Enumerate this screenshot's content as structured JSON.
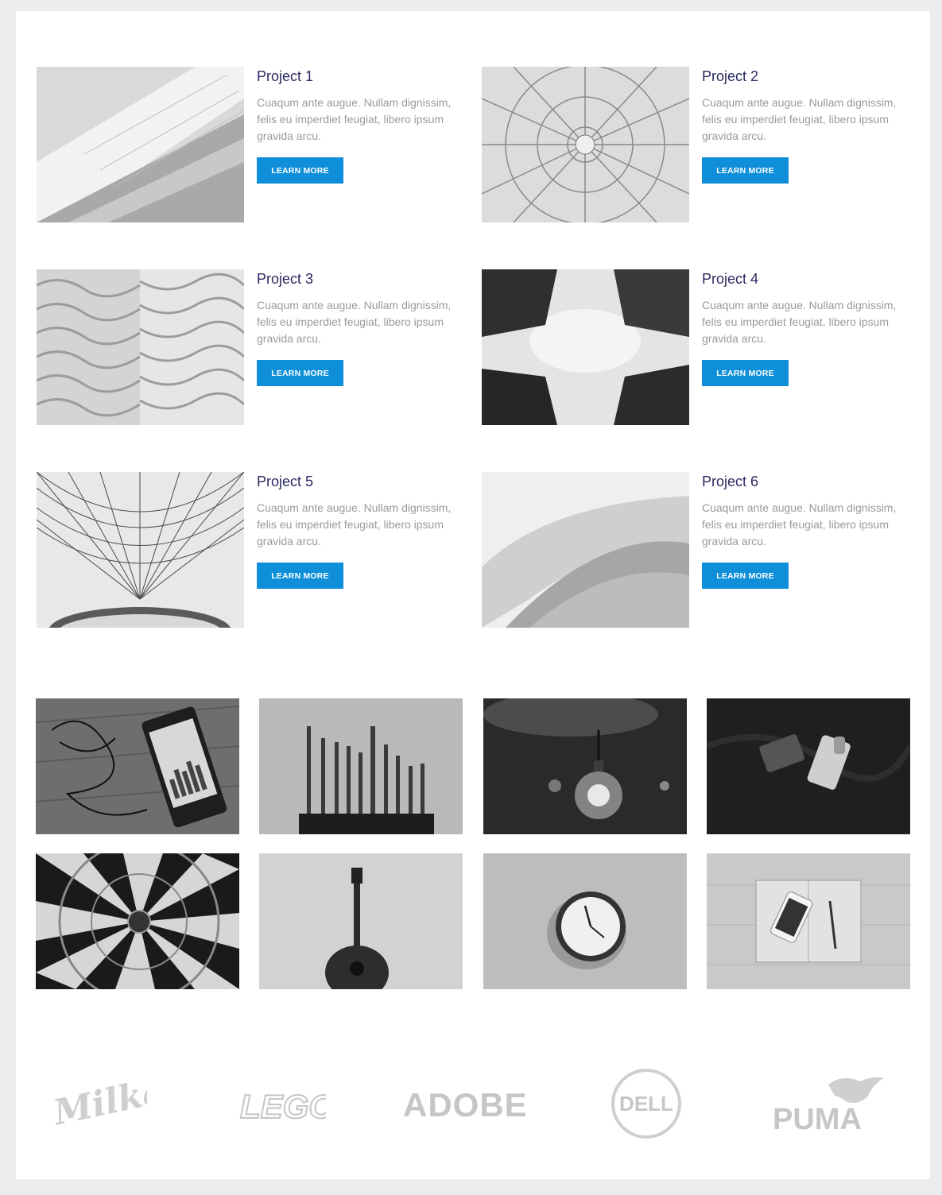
{
  "projects": [
    {
      "title": "Project 1",
      "description": "Cuaqum ante augue. Nullam dignissim, felis eu imperdiet feugiat, libero ipsum gravida arcu.",
      "button": "LEARN MORE"
    },
    {
      "title": "Project 2",
      "description": "Cuaqum ante augue. Nullam dignissim, felis eu imperdiet feugiat, libero ipsum gravida arcu.",
      "button": "LEARN MORE"
    },
    {
      "title": "Project 3",
      "description": "Cuaqum ante augue. Nullam dignissim, felis eu imperdiet feugiat, libero ipsum gravida arcu.",
      "button": "LEARN MORE"
    },
    {
      "title": "Project 4",
      "description": "Cuaqum ante augue. Nullam dignissim, felis eu imperdiet feugiat, libero ipsum gravida arcu.",
      "button": "LEARN MORE"
    },
    {
      "title": "Project 5",
      "description": "Cuaqum ante augue. Nullam dignissim, felis eu imperdiet feugiat, libero ipsum gravida arcu.",
      "button": "LEARN MORE"
    },
    {
      "title": "Project 6",
      "description": "Cuaqum ante augue. Nullam dignissim, felis eu imperdiet feugiat, libero ipsum gravida arcu.",
      "button": "LEARN MORE"
    }
  ],
  "gallery": [
    "phone-headphones",
    "drill-bits",
    "light-bulb",
    "phones-keys",
    "dartboard",
    "guitar",
    "wall-clock",
    "notebook-phone"
  ],
  "logos": {
    "milka": "Milka",
    "lego": "LEGO",
    "adobe": "ADOBE",
    "dell": "DELL",
    "puma": "PUMA"
  },
  "colors": {
    "accent": "#0f8fd9",
    "title": "#2b2a62",
    "text": "#9a9a9a",
    "logo": "#cfcfcf"
  }
}
